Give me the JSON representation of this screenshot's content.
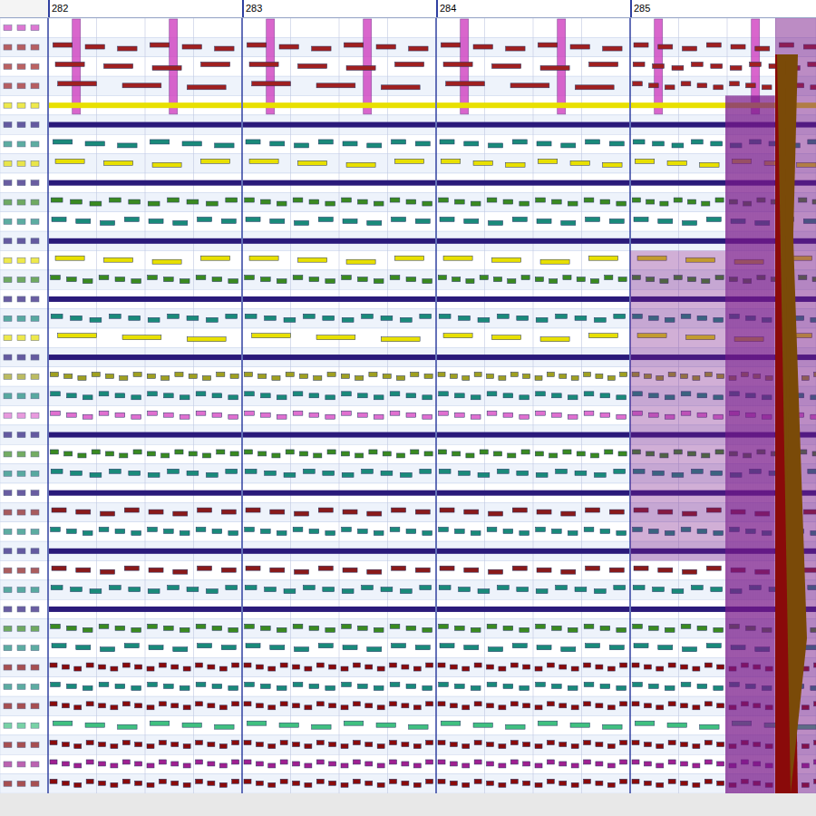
{
  "ruler": {
    "measures": [
      {
        "label": "282"
      },
      {
        "label": "283"
      },
      {
        "label": "284"
      },
      {
        "label": "285"
      }
    ]
  },
  "tracks": [
    {
      "kind": "beat",
      "color": "#d040c0",
      "density": [
        2,
        2,
        2,
        2
      ]
    },
    {
      "kind": "notes",
      "color": "#a02020",
      "density": [
        6,
        6,
        6,
        8
      ]
    },
    {
      "kind": "notes",
      "color": "#a02020",
      "density": [
        4,
        4,
        4,
        10
      ]
    },
    {
      "kind": "notes",
      "color": "#a02020",
      "density": [
        3,
        3,
        3,
        12
      ]
    },
    {
      "kind": "sustain",
      "color": "#e8e000",
      "density": [
        1,
        1,
        1,
        1
      ]
    },
    {
      "kind": "sustain",
      "color": "#2a1a7a",
      "density": [
        1,
        1,
        1,
        1
      ]
    },
    {
      "kind": "notes",
      "color": "#1a8a7a",
      "density": [
        6,
        8,
        8,
        10
      ]
    },
    {
      "kind": "notes",
      "color": "#e8e000",
      "density": [
        4,
        4,
        6,
        6
      ]
    },
    {
      "kind": "sustain",
      "color": "#2a1a7a",
      "density": [
        1,
        1,
        1,
        1
      ]
    },
    {
      "kind": "notes",
      "color": "#3a8a20",
      "density": [
        10,
        12,
        12,
        14
      ]
    },
    {
      "kind": "notes",
      "color": "#1a8a7a",
      "density": [
        8,
        8,
        8,
        8
      ]
    },
    {
      "kind": "sustain",
      "color": "#2a1a7a",
      "density": [
        1,
        1,
        1,
        1
      ]
    },
    {
      "kind": "notes",
      "color": "#e8e000",
      "density": [
        4,
        4,
        4,
        4
      ]
    },
    {
      "kind": "notes",
      "color": "#3a8a20",
      "density": [
        12,
        12,
        14,
        14
      ]
    },
    {
      "kind": "sustain",
      "color": "#2a1a7a",
      "density": [
        1,
        1,
        1,
        1
      ]
    },
    {
      "kind": "notes",
      "color": "#1a8a7a",
      "density": [
        10,
        10,
        10,
        12
      ]
    },
    {
      "kind": "notes",
      "color": "#e8e000",
      "density": [
        3,
        3,
        4,
        4
      ]
    },
    {
      "kind": "sustain",
      "color": "#2a1a7a",
      "density": [
        1,
        1,
        1,
        1
      ]
    },
    {
      "kind": "notes",
      "color": "#a0a020",
      "density": [
        14,
        14,
        16,
        16
      ]
    },
    {
      "kind": "notes",
      "color": "#1a8a7a",
      "density": [
        12,
        12,
        12,
        12
      ]
    },
    {
      "kind": "notes",
      "color": "#e070d0",
      "density": [
        12,
        12,
        12,
        12
      ]
    },
    {
      "kind": "sustain",
      "color": "#2a1a7a",
      "density": [
        1,
        1,
        1,
        1
      ]
    },
    {
      "kind": "notes",
      "color": "#3a8a20",
      "density": [
        14,
        14,
        14,
        14
      ]
    },
    {
      "kind": "notes",
      "color": "#1a8a7a",
      "density": [
        10,
        10,
        10,
        10
      ]
    },
    {
      "kind": "sustain",
      "color": "#2a1a7a",
      "density": [
        1,
        1,
        1,
        1
      ]
    },
    {
      "kind": "notes",
      "color": "#8a1a1a",
      "density": [
        8,
        8,
        8,
        8
      ]
    },
    {
      "kind": "notes",
      "color": "#1a8a7a",
      "density": [
        12,
        12,
        12,
        12
      ]
    },
    {
      "kind": "sustain",
      "color": "#2a1a7a",
      "density": [
        1,
        1,
        1,
        1
      ]
    },
    {
      "kind": "notes",
      "color": "#8a1a1a",
      "density": [
        8,
        8,
        8,
        8
      ]
    },
    {
      "kind": "notes",
      "color": "#1a8a7a",
      "density": [
        10,
        10,
        10,
        10
      ]
    },
    {
      "kind": "sustain",
      "color": "#2a1a7a",
      "density": [
        1,
        1,
        1,
        1
      ]
    },
    {
      "kind": "notes",
      "color": "#3a8a20",
      "density": [
        12,
        12,
        12,
        12
      ]
    },
    {
      "kind": "notes",
      "color": "#1a8a7a",
      "density": [
        8,
        8,
        8,
        8
      ]
    },
    {
      "kind": "notes",
      "color": "#8a0a0a",
      "density": [
        16,
        16,
        16,
        16
      ]
    },
    {
      "kind": "notes",
      "color": "#1a8a7a",
      "density": [
        12,
        12,
        12,
        12
      ]
    },
    {
      "kind": "notes",
      "color": "#8a0a0a",
      "density": [
        16,
        16,
        16,
        16
      ]
    },
    {
      "kind": "notes",
      "color": "#40c080",
      "density": [
        6,
        6,
        6,
        6
      ]
    },
    {
      "kind": "notes",
      "color": "#8a0a0a",
      "density": [
        16,
        16,
        16,
        16
      ]
    },
    {
      "kind": "notes",
      "color": "#a02090",
      "density": [
        16,
        16,
        16,
        16
      ]
    },
    {
      "kind": "notes",
      "color": "#8a0a0a",
      "density": [
        16,
        16,
        16,
        16
      ]
    }
  ],
  "dense_region": {
    "color": "#7a1a8a"
  },
  "end_marker": {
    "color": "#7a4a08",
    "accent": "#8a0a0a"
  }
}
